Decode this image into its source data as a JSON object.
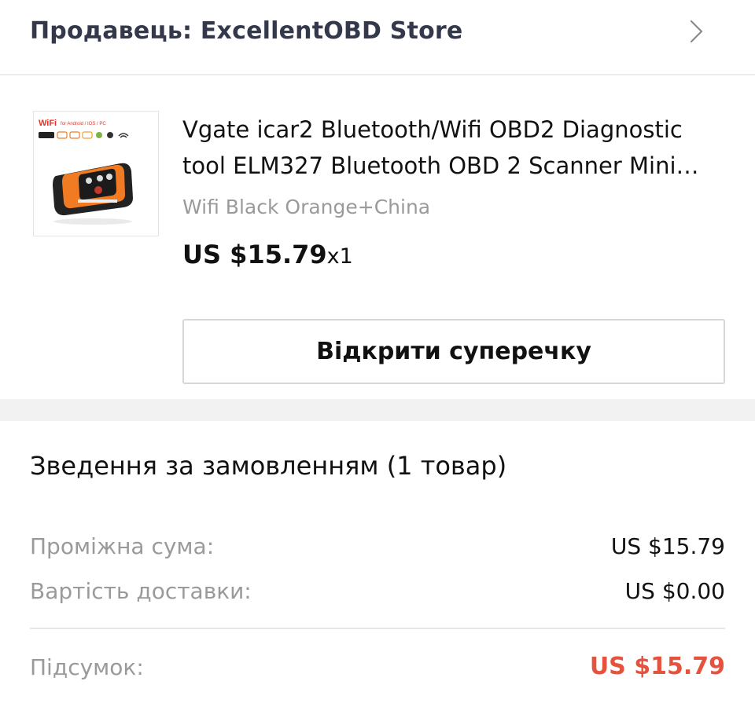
{
  "seller": {
    "label": "Продавець: ExcellentOBD Store",
    "chevron_icon": "chevron-right-icon"
  },
  "product": {
    "image_icon": "obd2-scanner-product-image",
    "image_badge": {
      "wifi": "WiFi",
      "platforms": "for Android / IOS / PC"
    },
    "title": "Vgate icar2 Bluetooth/Wifi OBD2 Diagnostic tool ELM327 Bluetooth OBD 2 Scanner Mini…",
    "variant": "Wifi Black Orange+China",
    "price": "US $15.79",
    "quantity": "x1"
  },
  "actions": {
    "open_dispute": "Відкрити суперечку"
  },
  "summary": {
    "title": "Зведення за замовленням (1 товар)",
    "subtotal_label": "Проміжна сума:",
    "subtotal_value": "US $15.79",
    "shipping_label": "Вартість доставки:",
    "shipping_value": "US $0.00",
    "total_label": "Підсумок:",
    "total_value": "US $15.79"
  },
  "colors": {
    "accent_total": "#e5533f",
    "product_orange": "#f07b22",
    "seller_text": "#33384a"
  }
}
